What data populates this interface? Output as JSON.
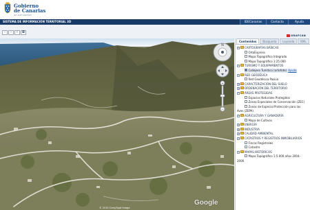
{
  "header": {
    "brand_line1": "Gobierno",
    "brand_line2": "de Canarias",
    "tagline": "un solo pueblo"
  },
  "navbar": {
    "title": "SISTEMA DE INFORMACIÓN TERRITORIAL 3D",
    "links": [
      "IDECanarias",
      "Contacto",
      "Ayuda"
    ]
  },
  "toolbar": {
    "tools": [
      "arrow-left-icon",
      "arrow-right-icon",
      "info-icon",
      "camera-icon"
    ],
    "grafcan": "GRAFCAN"
  },
  "map": {
    "attribution": "© 2010 Cnes/Spot Image",
    "google": "Google"
  },
  "panel": {
    "tabs": [
      "Contenidos",
      "Búsqueda",
      "Leyenda",
      "KML"
    ],
    "tree": [
      {
        "type": "group",
        "label": "CARTOGRAFÍAS BÁSICAS",
        "expanded": true
      },
      {
        "type": "item",
        "label": "OrtoExpress",
        "checked": false
      },
      {
        "type": "item",
        "label": "Mapa Topográfico Integrado",
        "checked": false
      },
      {
        "type": "item",
        "label": "Mapa Topográfico 1:25.000",
        "checked": false
      },
      {
        "type": "group",
        "label": "TURISMO Y EQUIPAMIENTOS",
        "expanded": true
      },
      {
        "type": "item",
        "label": "Callejero Turístico (ortofoto)",
        "checked": true,
        "link": "Ayuda"
      },
      {
        "type": "group",
        "label": "RED GEODÉSICA",
        "expanded": true
      },
      {
        "type": "item",
        "label": "Red Geodésica Pasiva",
        "checked": false
      },
      {
        "type": "group",
        "label": "CARACTERIZACIÓN DEL SUELO",
        "expanded": false
      },
      {
        "type": "group",
        "label": "ORDENACIÓN DEL TERRITORIO",
        "expanded": false
      },
      {
        "type": "group",
        "label": "ÁREAS PROTEGIDAS",
        "expanded": true
      },
      {
        "type": "item",
        "label": "Espacios Naturales Protegidos",
        "checked": false
      },
      {
        "type": "item",
        "label": "Zonas Especiales de Conservación (ZEC)",
        "checked": false
      },
      {
        "type": "item",
        "label": "Zonas de Especial Protección para las",
        "checked": false,
        "cont": "Aves (ZEPA)"
      },
      {
        "type": "group",
        "label": "AGRICULTURA Y GANADERÍA",
        "expanded": true
      },
      {
        "type": "item",
        "label": "Mapa de Cultivos",
        "checked": false
      },
      {
        "type": "group",
        "label": "ENERGÍA",
        "expanded": false
      },
      {
        "type": "group",
        "label": "INDUSTRIA",
        "expanded": false
      },
      {
        "type": "group",
        "label": "CALIDAD AMBIENTAL",
        "expanded": false
      },
      {
        "type": "group",
        "label": "CATASTROS Y REGISTROS INMOBILIARIOS",
        "expanded": true
      },
      {
        "type": "item",
        "label": "Fincas Registrales",
        "checked": false
      },
      {
        "type": "item",
        "label": "Catastro",
        "checked": false
      },
      {
        "type": "group",
        "label": "MAPAS HISTÓRICOS",
        "expanded": true
      },
      {
        "type": "item",
        "label": "Mapa Topográfico 1:5.000 años 2004-",
        "checked": false,
        "cont": "2006"
      }
    ]
  },
  "colors": {
    "navbar": "#173a67",
    "brand": "#1b4f8e",
    "folder": "#e8b94a",
    "link": "#1f5cab"
  }
}
